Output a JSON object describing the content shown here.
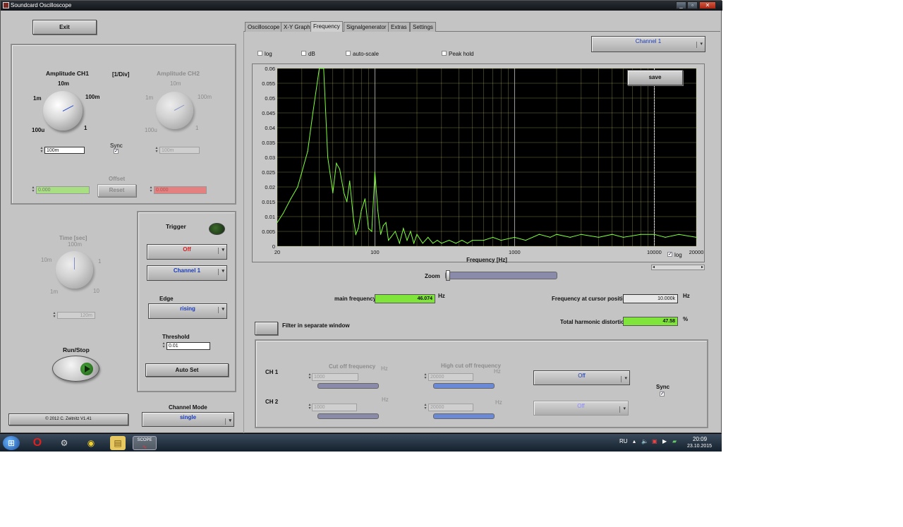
{
  "window": {
    "title": "Soundcard Oscilloscope"
  },
  "left": {
    "exit": "Exit",
    "amp_ch1": {
      "title": "Amplitude CH1",
      "labels": [
        "10m",
        "1m",
        "100m",
        "100u",
        "1"
      ],
      "value": "100m"
    },
    "div_unit": "[1/Div]",
    "amp_ch2": {
      "title": "Amplitude CH2",
      "labels": [
        "10m",
        "1m",
        "100m",
        "100u",
        "1"
      ],
      "value": "100m"
    },
    "sync": "Sync",
    "offset": {
      "title": "Offset",
      "ch1_value": "0.000",
      "ch2_value": "0.000",
      "reset": "Reset"
    },
    "time": {
      "title": "Time [sec]",
      "labels": [
        "100m",
        "10m",
        "1",
        "1m",
        "10"
      ],
      "value": "120m"
    },
    "run_stop": "Run/Stop",
    "copyright": "© 2012  C. Zeitnitz V1.41",
    "channel_mode": {
      "title": "Channel Mode",
      "value": "single"
    }
  },
  "trigger": {
    "title": "Trigger",
    "mode": "Off",
    "channel": "Channel 1",
    "edge_title": "Edge",
    "edge": "rising",
    "threshold_title": "Threshold",
    "threshold": "0.01",
    "autoset": "Auto Set"
  },
  "tabs": [
    {
      "label": "Oscilloscope"
    },
    {
      "label": "X-Y Graph"
    },
    {
      "label": "Frequency"
    },
    {
      "label": "Signalgenerator"
    },
    {
      "label": "Extras"
    },
    {
      "label": "Settings"
    }
  ],
  "freq": {
    "channel_select": "Channel 1",
    "opt_log": "log",
    "opt_db": "dB",
    "opt_autoscale": "auto-scale",
    "opt_peakhold": "Peak hold",
    "save": "save",
    "xaxis_log": "log",
    "zoom": "Zoom",
    "main_freq_label": "main frequency",
    "main_freq_value": "46.074",
    "main_freq_unit": "Hz",
    "cursor_label": "Frequency at cursor position",
    "cursor_value": "10.000k",
    "cursor_unit": "Hz",
    "thd_label": "Total harmonic distortion",
    "thd_value": "47.58",
    "thd_unit": "%",
    "filter_label": "Filter in separate window"
  },
  "filter": {
    "ch1": "CH 1",
    "ch2": "CH 2",
    "cutoff_title": "Cut off frequency",
    "high_cutoff_title": "High cut off frequency",
    "hz": "Hz",
    "ch1_cutoff": "1000",
    "ch1_high": "20000",
    "ch2_cutoff": "1000",
    "ch2_high": "20000",
    "ch1_mode": "Off",
    "ch2_mode": "Off",
    "sync": "Sync"
  },
  "taskbar": {
    "lang": "RU",
    "time": "20:09",
    "date": "23.10.2015",
    "scope_label": "SCOPE"
  },
  "colors": {
    "trace": "#7dff3a",
    "plot_bg": "#000000",
    "grid": "#c8c870",
    "accent_green": "#7fe53a"
  },
  "chart_data": {
    "type": "line",
    "xlabel": "Frequency [Hz]",
    "x_scale": "log",
    "xlim": [
      20,
      20000
    ],
    "ylim": [
      0,
      0.06
    ],
    "x_ticks": [
      "20",
      "100",
      "1000",
      "10000",
      "20000"
    ],
    "y_ticks": [
      "0",
      "0.005",
      "0.01",
      "0.015",
      "0.02",
      "0.025",
      "0.03",
      "0.035",
      "0.04",
      "0.045",
      "0.05",
      "0.055",
      "0.06"
    ],
    "cursor_x": 10000,
    "series": [
      {
        "x": [
          20,
          22,
          25,
          28,
          30,
          33,
          36,
          40,
          43,
          46,
          50,
          53,
          56,
          60,
          63,
          66,
          70,
          73,
          76,
          80,
          85,
          90,
          95,
          100,
          105,
          110,
          115,
          120,
          125,
          130,
          140,
          150,
          160,
          170,
          180,
          190,
          200,
          220,
          240,
          260,
          280,
          300,
          340,
          380,
          420,
          460,
          500,
          600,
          700,
          800,
          1000,
          1200,
          1500,
          1800,
          2000,
          2500,
          3000,
          4000,
          5000,
          6000,
          8000,
          10000,
          12000,
          15000,
          20000
        ],
        "y": [
          0.008,
          0.011,
          0.016,
          0.02,
          0.025,
          0.032,
          0.045,
          0.06,
          0.06,
          0.03,
          0.018,
          0.028,
          0.026,
          0.018,
          0.015,
          0.022,
          0.01,
          0.004,
          0.006,
          0.012,
          0.016,
          0.006,
          0.005,
          0.025,
          0.012,
          0.004,
          0.007,
          0.008,
          0.002,
          0.003,
          0.005,
          0.001,
          0.006,
          0.002,
          0.005,
          0.001,
          0.004,
          0.001,
          0.003,
          0.001,
          0.002,
          0.001,
          0.002,
          0.001,
          0.002,
          0.001,
          0.002,
          0.002,
          0.003,
          0.002,
          0.003,
          0.002,
          0.004,
          0.003,
          0.004,
          0.003,
          0.004,
          0.003,
          0.004,
          0.003,
          0.004,
          0.004,
          0.003,
          0.004,
          0.003
        ]
      }
    ]
  }
}
